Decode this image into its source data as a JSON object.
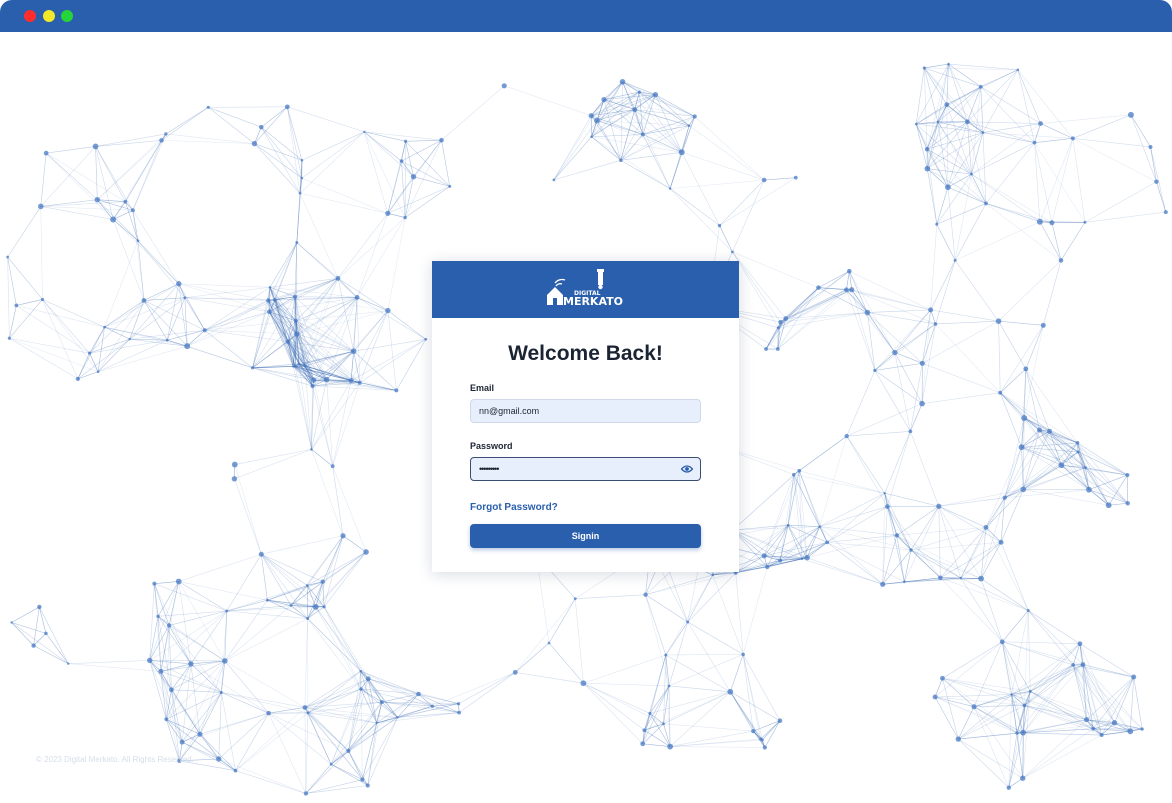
{
  "window": {
    "controls": [
      {
        "name": "close",
        "color": "#ff2d2d"
      },
      {
        "name": "minimize",
        "color": "#f3e92a"
      },
      {
        "name": "maximize",
        "color": "#26d33a"
      }
    ],
    "titlebar_color": "#2a5fad"
  },
  "brand": {
    "logo_top_text": "DIGITAL",
    "logo_main_text": "MERKATO",
    "color": "#2a5fad"
  },
  "login": {
    "title": "Welcome Back!",
    "email_label": "Email",
    "email_value": "nn@gmail.com",
    "password_label": "Password",
    "password_value": "•••••••••",
    "password_toggle_icon": "eye-icon",
    "forgot_label": "Forgot Password?",
    "signin_label": "Signin"
  },
  "footer": {
    "copyright": "© 2023 Digital Merkato. All Rights Reserved."
  }
}
